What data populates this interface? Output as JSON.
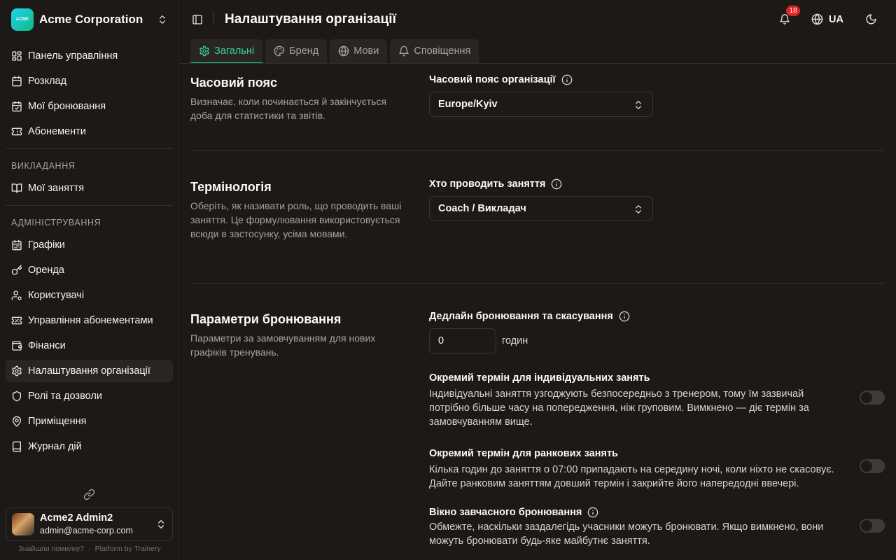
{
  "org": {
    "name": "Acme Corporation",
    "logo_text": "ACME"
  },
  "sidebar": {
    "main": [
      {
        "label": "Панель управління",
        "icon": "dashboard-icon"
      },
      {
        "label": "Розклад",
        "icon": "calendar-icon"
      },
      {
        "label": "Мої бронювання",
        "icon": "calendar-check-icon"
      },
      {
        "label": "Абонементи",
        "icon": "ticket-icon"
      }
    ],
    "teaching_group": "ВИКЛАДАННЯ",
    "teaching": [
      {
        "label": "Мої заняття",
        "icon": "book-open-icon"
      }
    ],
    "admin_group": "АДМІНІСТРУВАННЯ",
    "admin": [
      {
        "label": "Графіки",
        "icon": "calendar-range-icon"
      },
      {
        "label": "Оренда",
        "icon": "key-icon"
      },
      {
        "label": "Користувачі",
        "icon": "users-icon"
      },
      {
        "label": "Управління абонементами",
        "icon": "tickets-icon"
      },
      {
        "label": "Фінанси",
        "icon": "wallet-icon"
      },
      {
        "label": "Налаштування організації",
        "icon": "settings-icon",
        "active": true
      },
      {
        "label": "Ролі та дозволи",
        "icon": "shield-icon"
      },
      {
        "label": "Приміщення",
        "icon": "map-pin-icon"
      },
      {
        "label": "Журнал дій",
        "icon": "notebook-icon"
      }
    ]
  },
  "user": {
    "name": "Acme2 Admin2",
    "email": "admin@acme-corp.com"
  },
  "footer": {
    "bug_link": "Знайшли помилку?",
    "separator": "·",
    "platform": "Platform by Trainery"
  },
  "header": {
    "title": "Налаштування організації",
    "notifications_count": "18",
    "language": "UA"
  },
  "tabs": [
    {
      "label": "Загальні",
      "icon": "gear-icon",
      "active": true
    },
    {
      "label": "Бренд",
      "icon": "palette-icon"
    },
    {
      "label": "Мови",
      "icon": "globe-icon"
    },
    {
      "label": "Сповіщення",
      "icon": "bell-icon"
    }
  ],
  "timezone": {
    "title": "Часовий пояс",
    "description": "Визначає, коли починається й закінчується доба для статистики та звітів.",
    "field_label": "Часовий пояс організації",
    "value": "Europe/Kyiv"
  },
  "terminology": {
    "title": "Термінологія",
    "description": "Оберіть, як називати роль, що проводить ваші заняття. Це формулювання використовується всюди в застосунку, усіма мовами.",
    "field_label": "Хто проводить заняття",
    "value": "Coach / Викладач"
  },
  "booking": {
    "title": "Параметри бронювання",
    "description": "Параметри за замовчуванням для нових графіків тренувань.",
    "deadline_label": "Дедлайн бронювання та скасування",
    "deadline_value": "0",
    "deadline_unit": "годин",
    "options": [
      {
        "title": "Окремий термін для індивідуальних занять",
        "description": "Індивідуальні заняття узгоджують безпосередньо з тренером, тому їм зазвичай потрібно більше часу на попередження, ніж груповим. Вимкнено — діє термін за замовчуванням вище.",
        "enabled": false
      },
      {
        "title": "Окремий термін для ранкових занять",
        "description": "Кілька годин до заняття о 07:00 припадають на середину ночі, коли ніхто не скасовує. Дайте ранковим заняттям довший термін і закрийте його напередодні ввечері.",
        "enabled": false
      },
      {
        "title": "Вікно завчасного бронювання",
        "description": "Обмежте, наскільки заздалегідь учасники можуть бронювати. Якщо вимкнено, вони можуть бронювати будь-яке майбутнє заняття.",
        "enabled": false
      }
    ]
  }
}
